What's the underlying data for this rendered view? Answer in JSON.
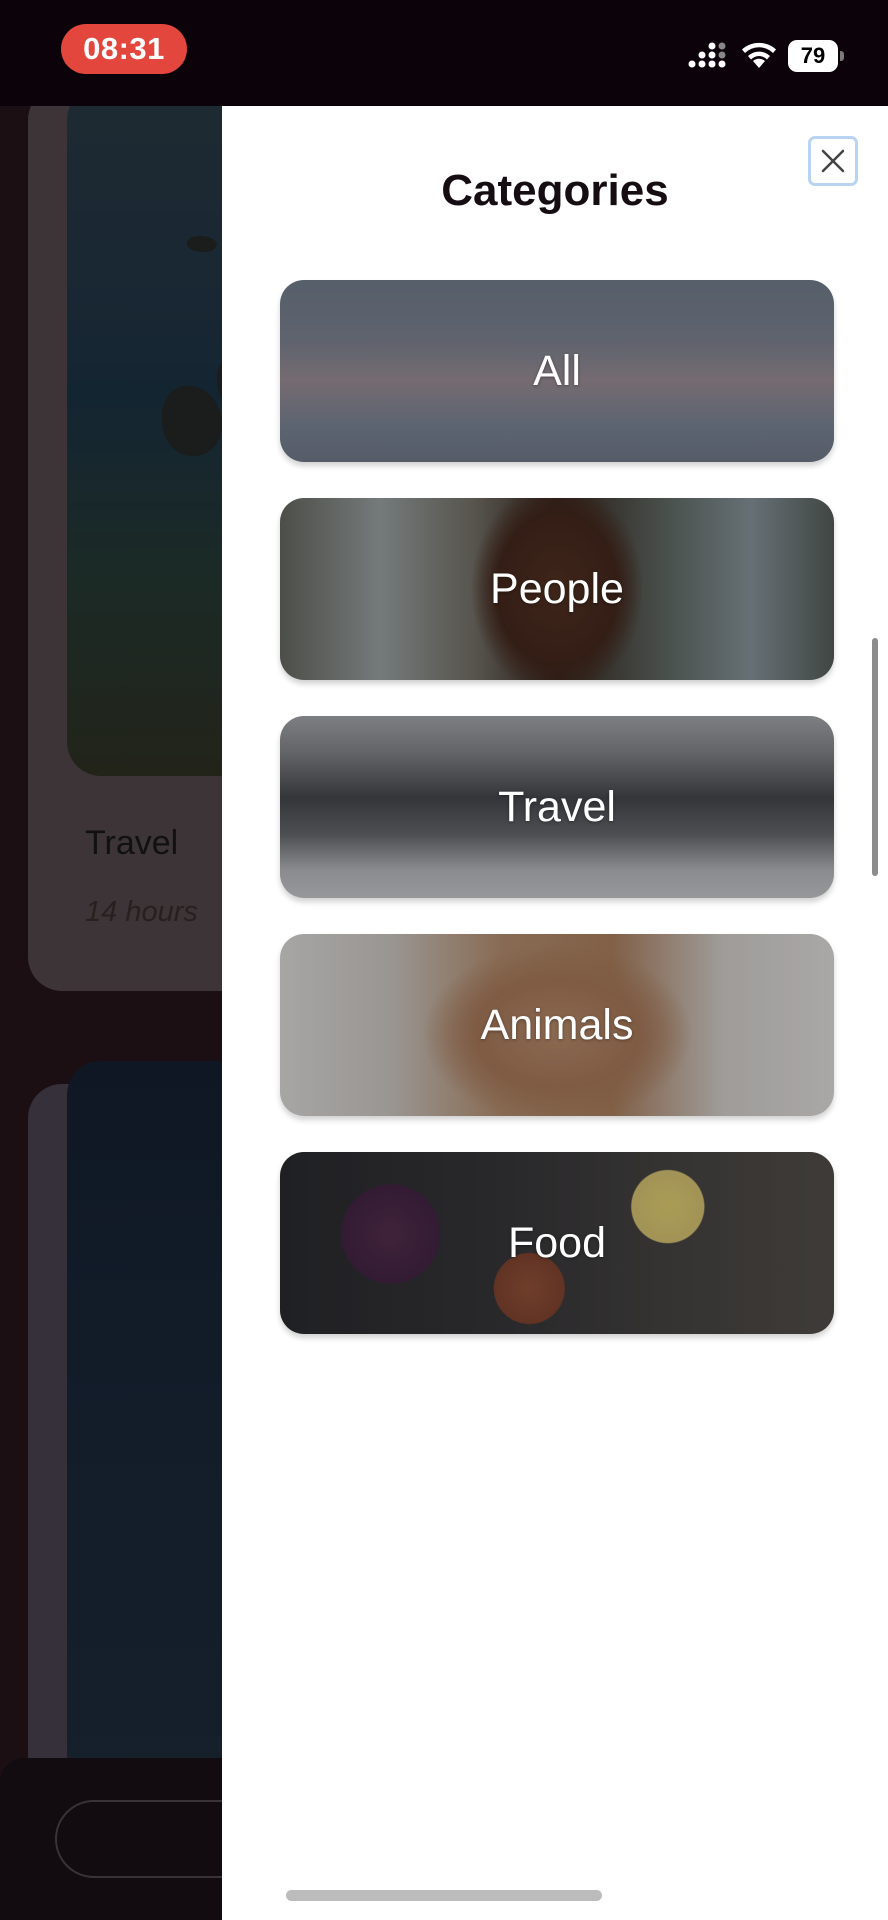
{
  "status_bar": {
    "time": "08:31",
    "battery": "79",
    "icons": [
      "signal-icon",
      "wifi-icon",
      "battery-icon"
    ]
  },
  "background_page": {
    "card_title": "Travel",
    "card_subtitle": "14 hours"
  },
  "drawer": {
    "title": "Categories",
    "close_icon": "close-icon",
    "categories": [
      {
        "label": "All"
      },
      {
        "label": "People"
      },
      {
        "label": "Travel"
      },
      {
        "label": "Animals"
      },
      {
        "label": "Food"
      }
    ]
  },
  "colors": {
    "time_pill": "#e2463c",
    "close_border": "#b9d3f2",
    "title_text": "#150d12"
  }
}
